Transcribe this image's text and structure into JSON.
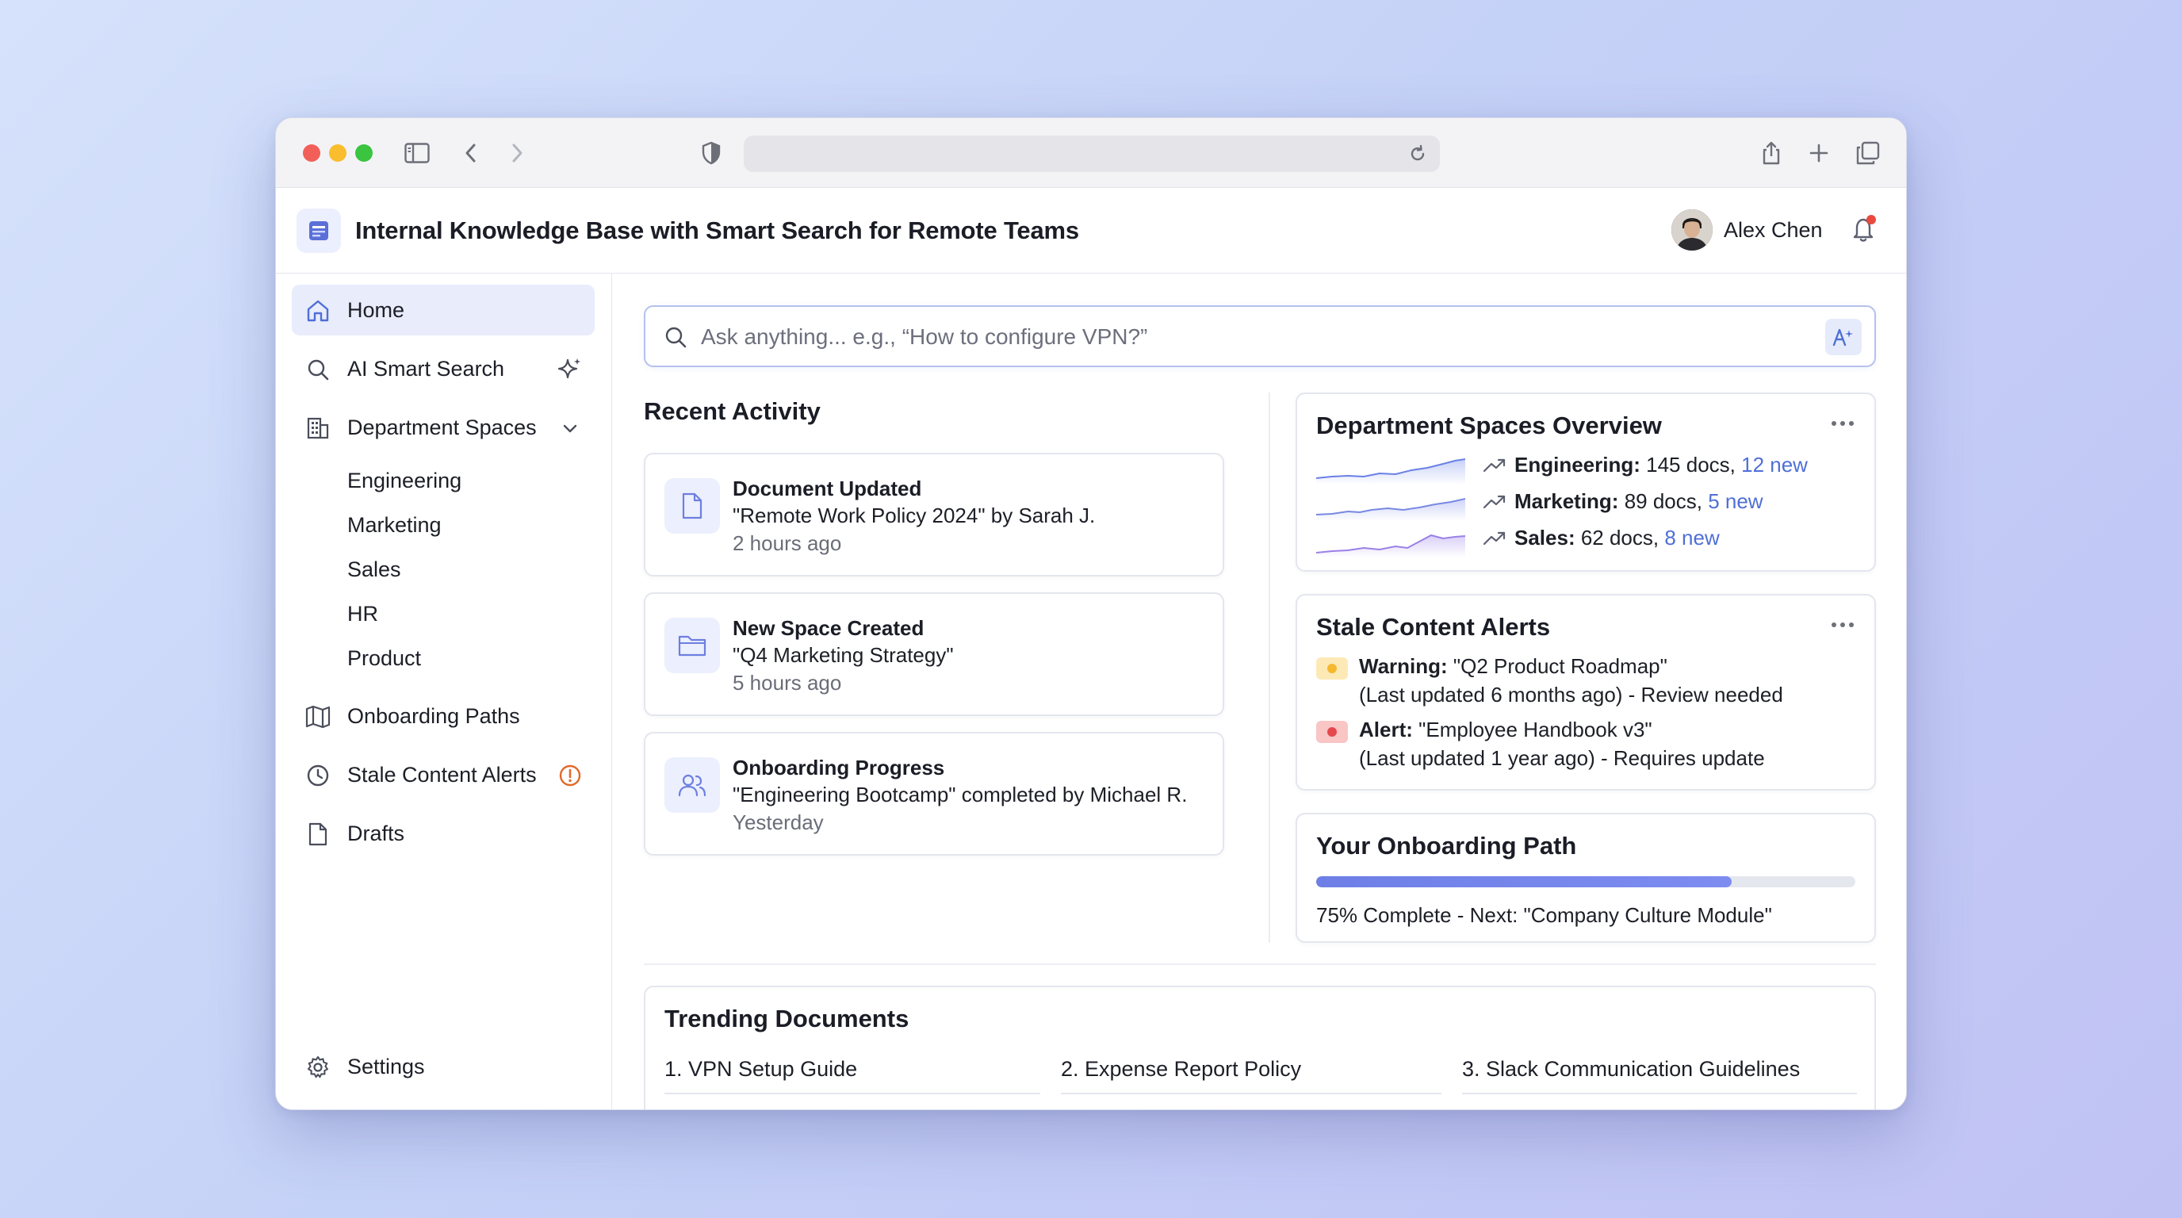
{
  "app": {
    "title": "Internal Knowledge Base with Smart Search for Remote Teams",
    "user_name": "Alex Chen"
  },
  "sidebar": {
    "home": "Home",
    "ai_search": "AI Smart Search",
    "department_spaces": "Department Spaces",
    "departments": [
      "Engineering",
      "Marketing",
      "Sales",
      "HR",
      "Product"
    ],
    "onboarding_paths": "Onboarding Paths",
    "stale_alerts": "Stale Content Alerts",
    "drafts": "Drafts",
    "settings": "Settings"
  },
  "search": {
    "placeholder": "Ask anything... e.g., “How to configure VPN?”"
  },
  "recent_activity": {
    "title": "Recent Activity",
    "items": [
      {
        "title": "Document Updated",
        "desc": "\"Remote Work Policy 2024\" by Sarah J.",
        "time": "2 hours ago",
        "icon": "document-icon"
      },
      {
        "title": "New Space Created",
        "desc": "\"Q4 Marketing Strategy\"",
        "time": "5 hours ago",
        "icon": "folder-icon"
      },
      {
        "title": "Onboarding Progress",
        "desc": "\"Engineering Bootcamp\" completed by Michael R.",
        "time": "Yesterday",
        "icon": "users-icon"
      }
    ]
  },
  "dept_overview": {
    "title": "Department Spaces Overview",
    "rows": [
      {
        "name": "Engineering:",
        "docs": " 145 docs, ",
        "new": "12 new"
      },
      {
        "name": "Marketing:",
        "docs": " 89 docs, ",
        "new": "5 new"
      },
      {
        "name": "Sales:",
        "docs": " 62 docs, ",
        "new": "8 new"
      }
    ]
  },
  "stale": {
    "title": "Stale Content Alerts",
    "items": [
      {
        "kind": "Warning:",
        "doc": " \"Q2 Product Roadmap\"",
        "detail": "(Last updated 6 months ago) - Review needed",
        "color": "#f5b82e",
        "bg": "#fde9b6"
      },
      {
        "kind": "Alert:",
        "doc": " \"Employee Handbook v3\"",
        "detail": "(Last updated 1 year ago) - Requires update",
        "color": "#e5484d",
        "bg": "#f9c5c5"
      }
    ]
  },
  "onboarding": {
    "title": "Your Onboarding Path",
    "progress": 0.77,
    "text": "75% Complete - Next: \"Company Culture Module\""
  },
  "trending": {
    "title": "Trending Documents",
    "items": [
      "1. VPN Setup Guide",
      "2. Expense Report Policy",
      "3. Slack Communication Guidelines"
    ]
  },
  "colors": {
    "accent": "#4f6fd6",
    "active_bg": "#e8ecfb",
    "warning": "#f5b82e",
    "alert": "#e5484d",
    "stale_badge": "#e06a2c"
  }
}
